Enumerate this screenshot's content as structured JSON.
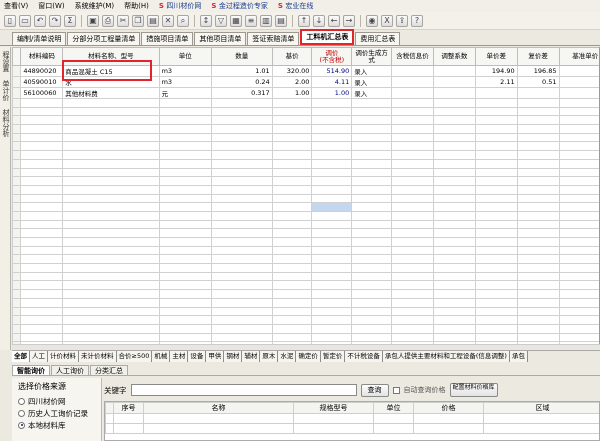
{
  "menu": [
    {
      "label": "查看(V)",
      "link": false
    },
    {
      "label": "窗口(W)",
      "link": false
    },
    {
      "label": "系统维护(M)",
      "link": false
    },
    {
      "label": "帮助(H)",
      "link": false
    },
    {
      "label": "四川材价网",
      "link": true
    },
    {
      "label": "金过程造价专家",
      "link": true
    },
    {
      "label": "宏业在线",
      "link": true
    }
  ],
  "toolbar_icons": [
    "new-icon",
    "open-icon",
    "undo-icon",
    "redo-icon",
    "calc-icon",
    "save-icon",
    "print-icon",
    "cut-icon",
    "copy-icon",
    "paste-icon",
    "delete-icon",
    "find-icon",
    "sort-icon",
    "filter-icon",
    "grid-icon",
    "list-icon",
    "column-icon",
    "report-icon",
    "up-icon",
    "down-icon",
    "left-icon",
    "right-icon",
    "view-icon",
    "excel-icon",
    "export-icon",
    "help-icon"
  ],
  "vertical_tabs": [
    "程设置",
    "单计价",
    "材料分析"
  ],
  "tabs": [
    {
      "label": "编制/清单说明",
      "active": false
    },
    {
      "label": "分部分项工程量清单",
      "active": false
    },
    {
      "label": "措施项目清单",
      "active": false
    },
    {
      "label": "其他项目清单",
      "active": false
    },
    {
      "label": "签证索赔清单",
      "active": false
    },
    {
      "label": "工料机汇总表",
      "active": true
    },
    {
      "label": "费用汇总表",
      "active": false
    }
  ],
  "columns": [
    "材料编码",
    "材料名称、型号",
    "单位",
    "数量",
    "基价",
    "调价\n(不含税)",
    "调价生成方式",
    "含税信息价",
    "调整系数",
    "单价差",
    "复价差",
    "基准单价"
  ],
  "rows": [
    {
      "code": "44890020",
      "name": "商品混凝土 C15",
      "unit": "m3",
      "qty": "1.01",
      "base": "320.00",
      "adj": "514.90",
      "method": "录入",
      "tax": "",
      "coef": "",
      "diff": "194.90",
      "total_diff": "196.85",
      "ref": ""
    },
    {
      "code": "40590010",
      "name": "水",
      "unit": "m3",
      "qty": "0.24",
      "base": "2.00",
      "adj": "4.11",
      "method": "录入",
      "tax": "",
      "coef": "",
      "diff": "2.11",
      "total_diff": "0.51",
      "ref": ""
    },
    {
      "code": "56100060",
      "name": "其他材料费",
      "unit": "元",
      "qty": "0.317",
      "base": "1.00",
      "adj": "1.00",
      "method": "录入",
      "tax": "",
      "coef": "",
      "diff": "",
      "total_diff": "",
      "ref": ""
    }
  ],
  "bottom_tabs": [
    "全部",
    "人工",
    "计价材料",
    "未计价材料",
    "合价≥500",
    "机械",
    "主材",
    "设备",
    "甲供",
    "钢材",
    "辅材",
    "原木",
    "水泥",
    "确定价",
    "暂定价",
    "不计税设备",
    "承包人提供主要材料和工程设备(信息调整)",
    "承包"
  ],
  "panel_tabs": [
    {
      "label": "智能询价",
      "active": true
    },
    {
      "label": "人工询价",
      "active": false
    },
    {
      "label": "分类汇总",
      "active": false
    }
  ],
  "price_source": {
    "title": "选择价格来源",
    "options": [
      {
        "label": "四川材价网",
        "selected": false
      },
      {
        "label": "历史人工询价记录",
        "selected": false
      },
      {
        "label": "本地材料库",
        "selected": true
      }
    ]
  },
  "search": {
    "label": "关键字",
    "value": "",
    "button": "查询",
    "auto_label": "自动查询价格",
    "config_button": "配置材料价格库"
  },
  "price_columns": [
    "序号",
    "名称",
    "规格型号",
    "单位",
    "价格",
    "区域"
  ]
}
